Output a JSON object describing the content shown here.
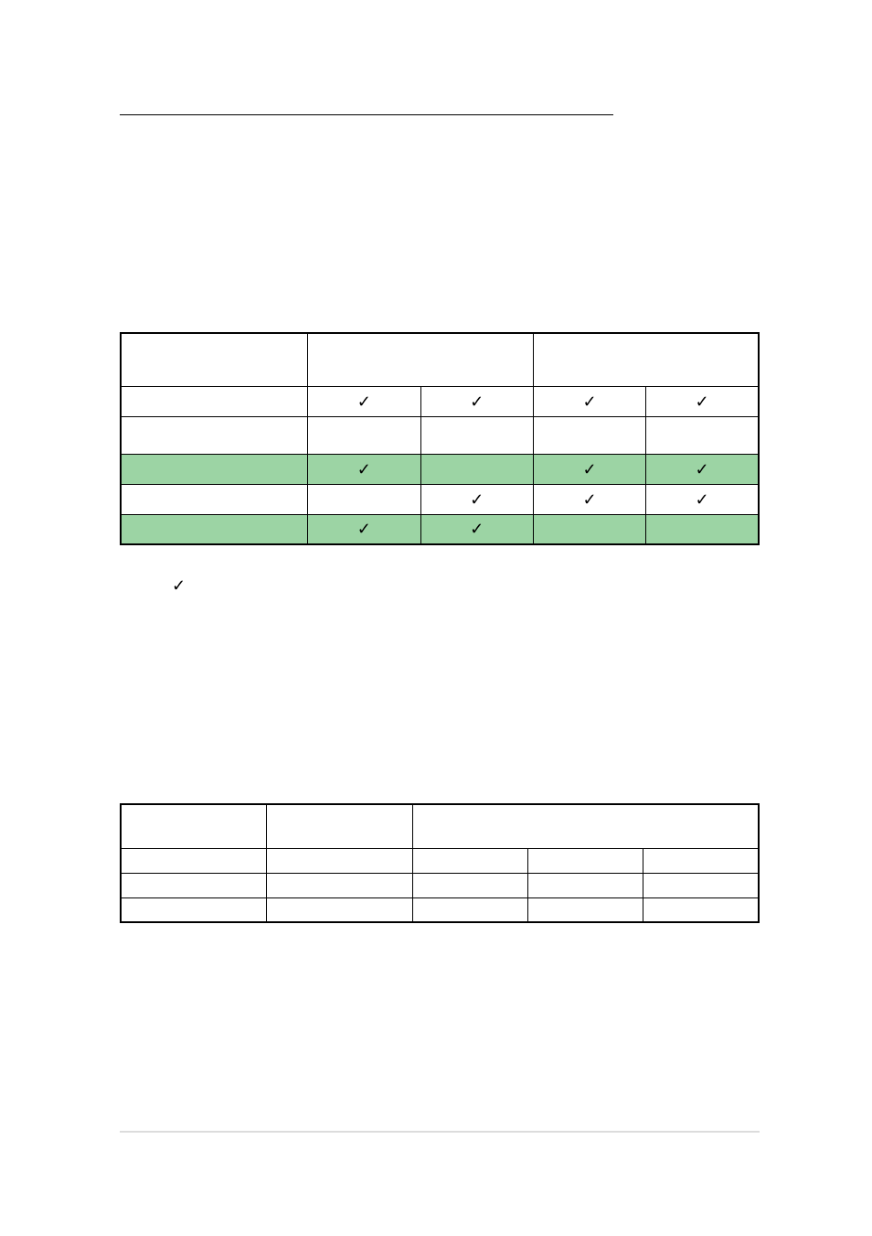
{
  "table1": {
    "headers": {
      "col1": "",
      "group1": "",
      "group2": "",
      "sub1": "",
      "sub2": "",
      "sub3": "",
      "sub4": ""
    },
    "rows": [
      {
        "label": "",
        "c1": "✓",
        "c2": "✓",
        "c3": "✓",
        "c4": "✓",
        "green": false
      },
      {
        "label": "",
        "c1": "",
        "c2": "",
        "c3": "",
        "c4": "",
        "green": false
      },
      {
        "label": "",
        "c1": "✓",
        "c2": "",
        "c3": "✓",
        "c4": "✓",
        "green": true
      },
      {
        "label": "",
        "c1": "",
        "c2": "✓",
        "c3": "✓",
        "c4": "✓",
        "green": false
      },
      {
        "label": "",
        "c1": "✓",
        "c2": "✓",
        "c3": "",
        "c4": "",
        "green": true
      }
    ]
  },
  "note_check": "✓",
  "table2": {
    "headers": {
      "col1": "",
      "col2": "",
      "group3": "",
      "sub1": "",
      "sub2": "",
      "sub3": ""
    },
    "rows": [
      {
        "a": "",
        "b": "",
        "c1": "",
        "c2": "",
        "c3": ""
      },
      {
        "a": "",
        "b": "",
        "c1": "",
        "c2": "",
        "c3": ""
      },
      {
        "a": "",
        "b": "",
        "c1": "",
        "c2": "",
        "c3": ""
      }
    ]
  }
}
